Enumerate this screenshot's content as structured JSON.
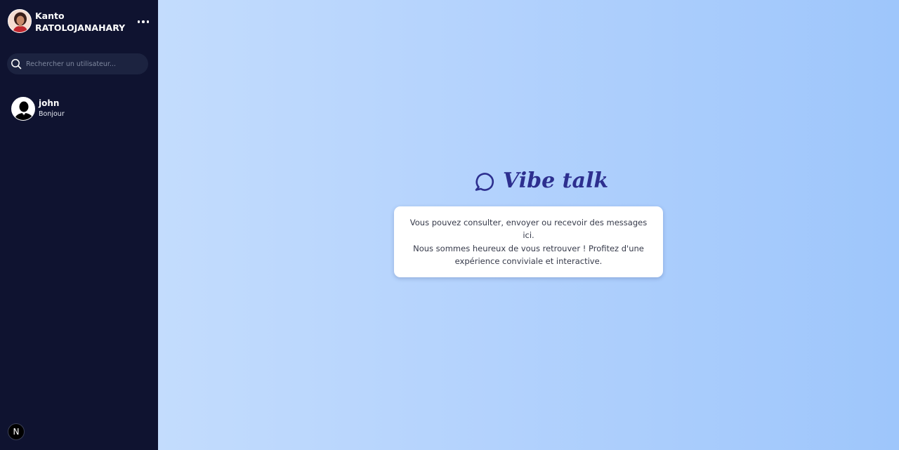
{
  "sidebar": {
    "user": {
      "first_name": "Kanto",
      "last_name": "RATOLOJANAHARY",
      "avatar_icon": "user-avatar"
    },
    "menu_icon": "more-horizontal-icon",
    "search": {
      "placeholder": "Rechercher un utilisateur...",
      "value": ""
    },
    "conversations": [
      {
        "name": "john",
        "last_message": "Bonjour"
      }
    ],
    "footer_badge": "N"
  },
  "main": {
    "brand": {
      "title": "Vibe talk",
      "icon": "chat-bubble-icon",
      "color": "#2d2f8f"
    },
    "welcome_lines": [
      "Vous pouvez consulter, envoyer ou recevoir des messages ici.",
      "Nous sommes heureux de vous retrouver ! Profitez d'une",
      "expérience conviviale et interactive."
    ]
  },
  "colors": {
    "sidebar_bg": "#0f1330",
    "main_gradient_start": "#c3dcfd",
    "main_gradient_end": "#9ec6fb"
  }
}
